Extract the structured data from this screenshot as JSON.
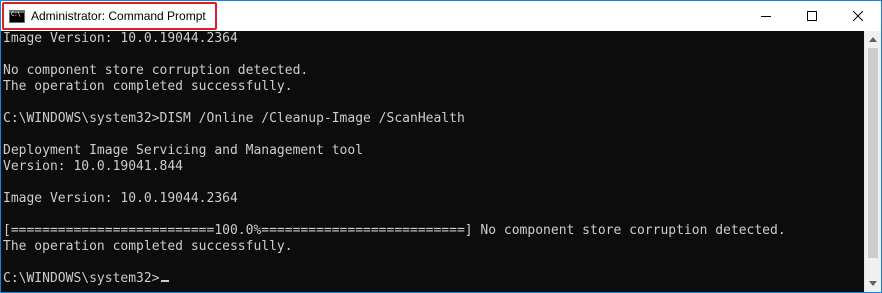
{
  "window": {
    "title": "Administrator: Command Prompt",
    "icon": "cmd-icon",
    "controls": [
      "minimize-icon",
      "maximize-icon",
      "close-icon"
    ],
    "colors": {
      "highlight_border": "#e01c24",
      "console_bg": "#0c0c0c",
      "console_text": "#cccccc"
    }
  },
  "console": {
    "lines": [
      "Image Version: 10.0.19044.2364",
      "",
      "No component store corruption detected.",
      "The operation completed successfully.",
      "",
      "C:\\WINDOWS\\system32>DISM /Online /Cleanup-Image /ScanHealth",
      "",
      "Deployment Image Servicing and Management tool",
      "Version: 10.0.19041.844",
      "",
      "Image Version: 10.0.19044.2364",
      "",
      "[==========================100.0%==========================] No component store corruption detected.",
      "The operation completed successfully.",
      "",
      "C:\\WINDOWS\\system32>"
    ]
  }
}
